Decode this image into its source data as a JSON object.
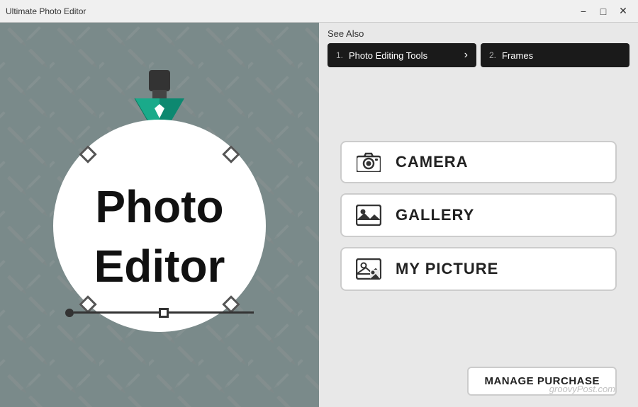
{
  "titlebar": {
    "title": "Ultimate Photo Editor",
    "minimize_label": "−",
    "maximize_label": "□",
    "close_label": "✕"
  },
  "left": {
    "logo_line1": "Photo",
    "logo_line2": "Editor"
  },
  "right": {
    "see_also_title": "See Also",
    "see_also_items": [
      {
        "num": "1.",
        "text": "Photo Editing Tools",
        "has_chevron": true
      },
      {
        "num": "2.",
        "text": "Frames",
        "partial": true
      }
    ],
    "buttons": [
      {
        "icon": "camera",
        "label": "CAMERA"
      },
      {
        "icon": "gallery",
        "label": "GALLERY"
      },
      {
        "icon": "picture",
        "label": "MY PICTURE"
      }
    ],
    "manage_btn_label": "MANAGE PURCHASE",
    "watermark": "groovyPost.com"
  }
}
